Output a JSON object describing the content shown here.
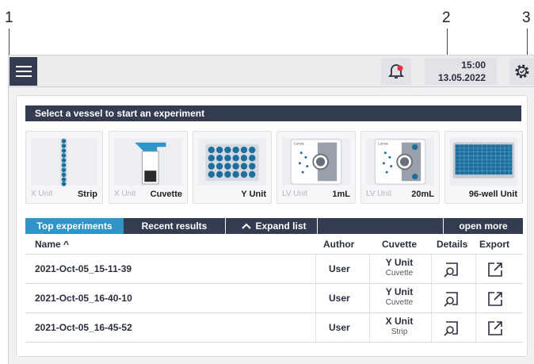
{
  "callouts": [
    "1",
    "2",
    "3"
  ],
  "topbar": {
    "menu_icon": "hamburger-menu-icon",
    "bell_icon": "notification-bell-icon",
    "time": "15:00",
    "date": "13.05.2022",
    "gear_icon": "gear-icon",
    "alert_color": "#e8303a"
  },
  "vessel_section": {
    "header": "Select a vessel to start an experiment",
    "vessels": [
      {
        "sub": "X Unit",
        "main": "Strip"
      },
      {
        "sub": "X Unit",
        "main": "Cuvette"
      },
      {
        "sub": "",
        "main": "Y Unit"
      },
      {
        "sub": "LV Unit",
        "main": "1mL"
      },
      {
        "sub": "LV Unit",
        "main": "20mL"
      },
      {
        "sub": "",
        "main": "96-well Unit"
      }
    ]
  },
  "tabs": {
    "top_experiments": "Top experiments",
    "recent_results": "Recent results",
    "expand_list": "Expand list",
    "open_more": "open more"
  },
  "table": {
    "headers": {
      "name": "Name ^",
      "author": "Author",
      "cuvette": "Cuvette",
      "details": "Details",
      "export": "Export"
    },
    "rows": [
      {
        "name": "2021-Oct-05_15-11-39",
        "author": "User",
        "unit": "Y Unit",
        "vessel": "Cuvette"
      },
      {
        "name": "2021-Oct-05_16-40-10",
        "author": "User",
        "unit": "Y Unit",
        "vessel": "Cuvette"
      },
      {
        "name": "2021-Oct-05_16-45-52",
        "author": "User",
        "unit": "X Unit",
        "vessel": "Strip"
      }
    ]
  },
  "colors": {
    "dark": "#343c52",
    "accent": "#2f94c6",
    "well": "#1f6f9e"
  }
}
